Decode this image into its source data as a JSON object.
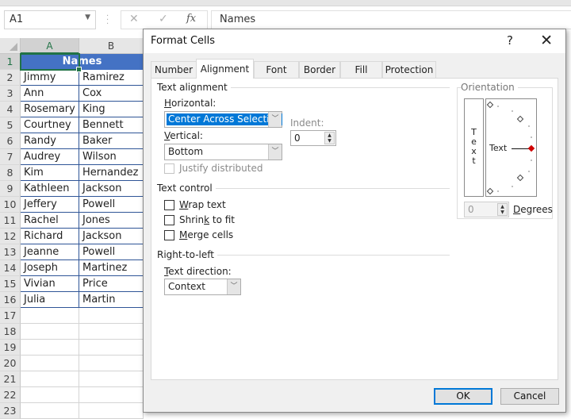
{
  "excel": {
    "name_box": "A1",
    "formula_icons": {
      "cancel": "✕",
      "enter": "✓",
      "function": "fx"
    },
    "formula_value": "Names",
    "columns": [
      "A",
      "B"
    ],
    "header_text": "Names",
    "rows": [
      {
        "num": "1"
      },
      {
        "num": "2",
        "a": "Jimmy",
        "b": "Ramirez"
      },
      {
        "num": "3",
        "a": "Ann",
        "b": "Cox"
      },
      {
        "num": "4",
        "a": "Rosemary",
        "b": "King"
      },
      {
        "num": "5",
        "a": "Courtney",
        "b": "Bennett"
      },
      {
        "num": "6",
        "a": "Randy",
        "b": "Baker"
      },
      {
        "num": "7",
        "a": "Audrey",
        "b": "Wilson"
      },
      {
        "num": "8",
        "a": "Kim",
        "b": "Hernandez"
      },
      {
        "num": "9",
        "a": "Kathleen",
        "b": "Jackson"
      },
      {
        "num": "10",
        "a": "Jeffery",
        "b": "Powell"
      },
      {
        "num": "11",
        "a": "Rachel",
        "b": "Jones"
      },
      {
        "num": "12",
        "a": "Richard",
        "b": "Jackson"
      },
      {
        "num": "13",
        "a": "Jeanne",
        "b": "Powell"
      },
      {
        "num": "14",
        "a": "Joseph",
        "b": "Martinez"
      },
      {
        "num": "15",
        "a": "Vivian",
        "b": "Price"
      },
      {
        "num": "16",
        "a": "Julia",
        "b": "Martin"
      },
      {
        "num": "17"
      },
      {
        "num": "18"
      },
      {
        "num": "19"
      },
      {
        "num": "20"
      },
      {
        "num": "21"
      },
      {
        "num": "22"
      },
      {
        "num": "23"
      }
    ],
    "colors": {
      "header_fill": "#4472c4",
      "selection": "#217346",
      "table_border": "#2f5597"
    }
  },
  "dialog": {
    "title": "Format Cells",
    "help": "?",
    "close": "✕",
    "tabs": [
      {
        "label": "Number",
        "active": false
      },
      {
        "label": "Alignment",
        "active": true
      },
      {
        "label": "Font",
        "active": false
      },
      {
        "label": "Border",
        "active": false
      },
      {
        "label": "Fill",
        "active": false
      },
      {
        "label": "Protection",
        "active": false
      }
    ],
    "text_alignment": {
      "group": "Text alignment",
      "horizontal_label": "Horizontal:",
      "horizontal_value": "Center Across Selection",
      "vertical_label": "Vertical:",
      "vertical_value": "Bottom",
      "indent_label": "Indent:",
      "indent_value": "0",
      "justify_distributed": {
        "label": "Justify distributed",
        "checked": false,
        "enabled": false
      }
    },
    "text_control": {
      "group": "Text control",
      "wrap_text": {
        "label": "Wrap text",
        "checked": false
      },
      "shrink_to_fit": {
        "label": "Shrink to fit",
        "checked": false
      },
      "merge_cells": {
        "label": "Merge cells",
        "checked": false
      }
    },
    "right_to_left": {
      "group": "Right-to-left",
      "direction_label": "Text direction:",
      "direction_value": "Context"
    },
    "orientation": {
      "group": "Orientation",
      "vertical_text_letters": [
        "T",
        "e",
        "x",
        "t"
      ],
      "dial_text": "Text",
      "degrees_value": "0",
      "degrees_label": "Degrees"
    },
    "ok": "OK",
    "cancel": "Cancel"
  }
}
